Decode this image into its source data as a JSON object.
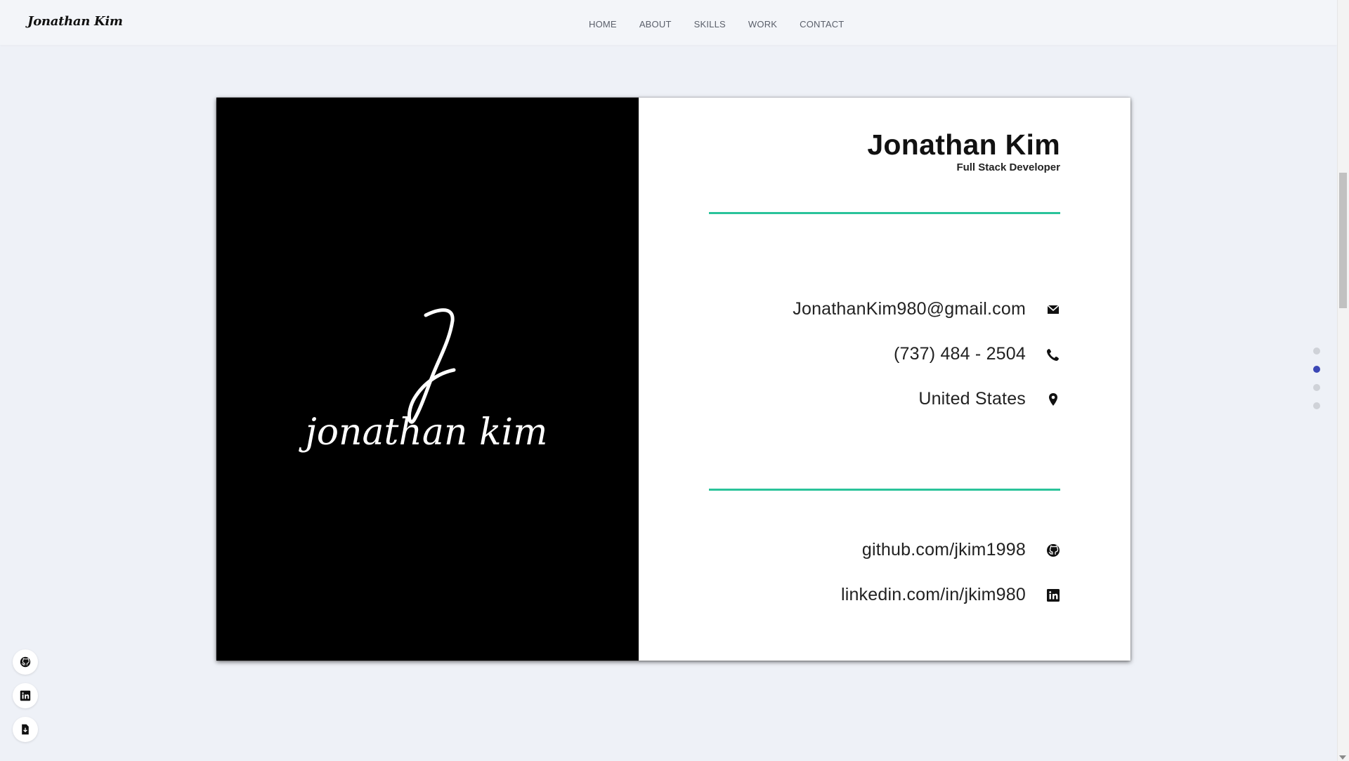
{
  "brand": {
    "name": "Jonathan Kim"
  },
  "nav": {
    "items": [
      "HOME",
      "ABOUT",
      "SKILLS",
      "WORK",
      "CONTACT"
    ]
  },
  "card": {
    "logo": {
      "initial": "J",
      "wordmark": "jonathan kim"
    },
    "name": "Jonathan Kim",
    "role": "Full Stack Developer",
    "contact": [
      {
        "text": "JonathanKim980@gmail.com",
        "icon": "mail-icon"
      },
      {
        "text": "(737) 484 - 2504",
        "icon": "phone-icon"
      },
      {
        "text": "United States",
        "icon": "location-pin-icon"
      }
    ],
    "social": [
      {
        "text": "github.com/jkim1998",
        "icon": "github-icon"
      },
      {
        "text": "linkedin.com/in/jkim980",
        "icon": "linkedin-icon"
      }
    ]
  },
  "section_dots": {
    "count": 4,
    "active_index": 1
  },
  "side_buttons": [
    "github-icon",
    "linkedin-icon",
    "resume-download-icon"
  ],
  "colors": {
    "accent": "#2ac39a",
    "active_dot": "#3b47b5",
    "card_left": "#000000"
  }
}
